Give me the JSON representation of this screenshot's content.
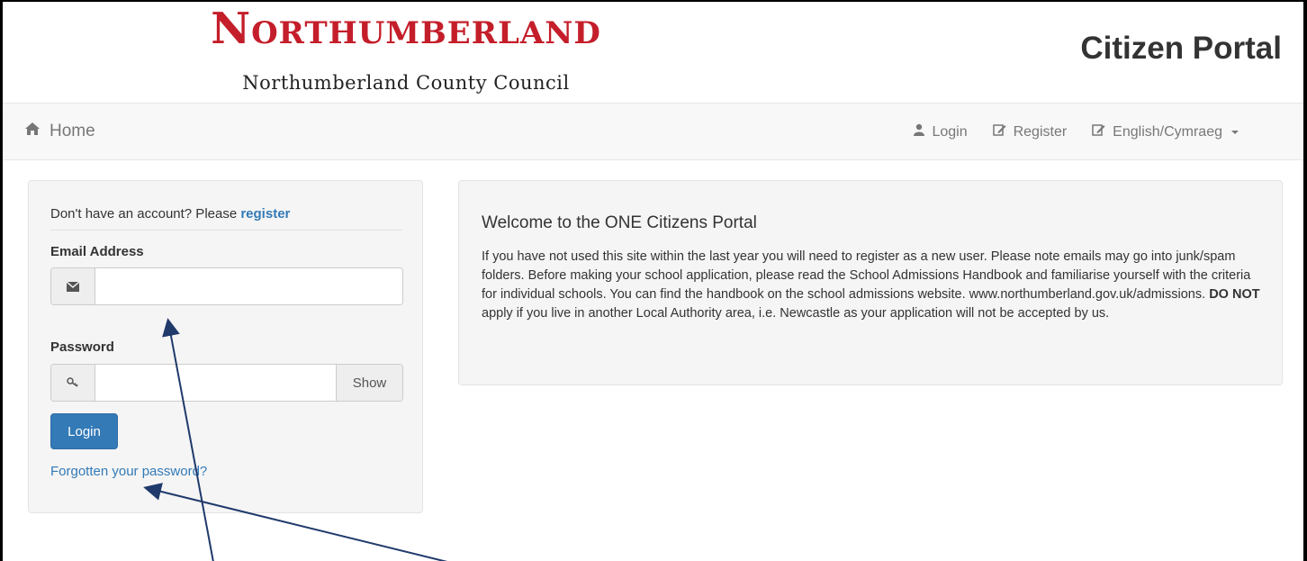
{
  "header": {
    "logo_text": "Northumberland",
    "logo_subtext": "Northumberland County Council",
    "portal_title": "Citizen Portal"
  },
  "nav": {
    "home": "Home",
    "login": "Login",
    "register": "Register",
    "language": "English/Cymraeg"
  },
  "login_panel": {
    "no_account_text": "Don't have an account? Please ",
    "register_link": "register",
    "email_label": "Email Address",
    "email_value": "",
    "password_label": "Password",
    "password_value": "",
    "show_label": "Show",
    "login_button": "Login",
    "forgot_link": "Forgotten your password?"
  },
  "welcome": {
    "title": "Welcome to the ONE Citizens Portal",
    "body_part1": "If you have not used this site within the last year you will need to register as a new user. Please note emails may go into junk/spam folders. Before making your school application, please read the School Admissions Handbook and familiarise yourself with the criteria for individual schools. You can find the handbook on the school admissions website. www.northumberland.gov.uk/admissions. ",
    "body_bold": "DO NOT",
    "body_part2": " apply if you live in another Local Authority area, i.e. Newcastle as your application will not be accepted by us."
  },
  "colors": {
    "brand_red": "#c41e2a",
    "link_blue": "#337ab7",
    "arrow_navy": "#1f3a6b"
  },
  "icons": [
    "home-icon",
    "user-icon",
    "edit-icon",
    "envelope-icon",
    "key-icon",
    "caret-down-icon"
  ]
}
